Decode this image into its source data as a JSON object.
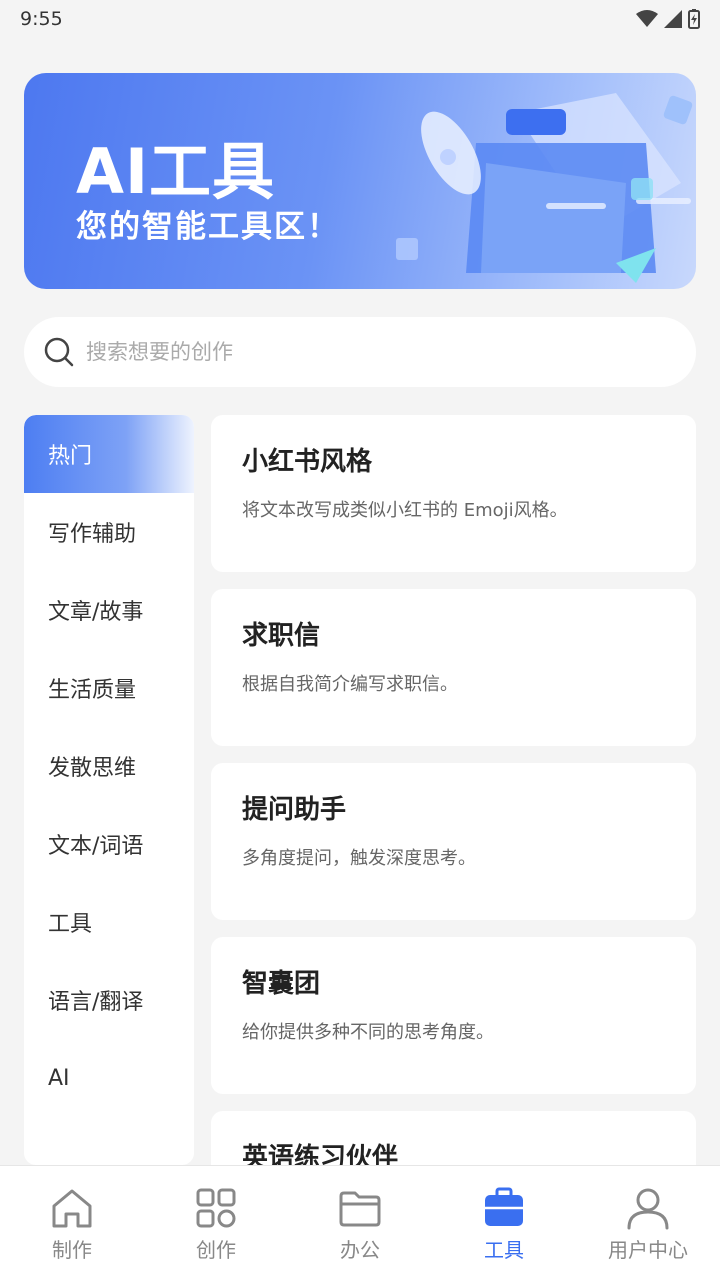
{
  "status_bar": {
    "time": "9:55"
  },
  "banner": {
    "title": "AI工具",
    "subtitle": "您的智能工具区！"
  },
  "search": {
    "placeholder": "搜索想要的创作",
    "value": ""
  },
  "categories": [
    {
      "label": "热门",
      "active": true
    },
    {
      "label": "写作辅助"
    },
    {
      "label": "文章/故事"
    },
    {
      "label": "生活质量"
    },
    {
      "label": "发散思维"
    },
    {
      "label": "文本/词语"
    },
    {
      "label": "工具"
    },
    {
      "label": "语言/翻译"
    },
    {
      "label": "AI"
    }
  ],
  "tools": [
    {
      "title": "小红书风格",
      "desc": "将文本改写成类似小红书的 Emoji风格。"
    },
    {
      "title": "求职信",
      "desc": "根据自我简介编写求职信。"
    },
    {
      "title": "提问助手",
      "desc": "多角度提问，触发深度思考。"
    },
    {
      "title": "智囊团",
      "desc": "给你提供多种不同的思考角度。"
    },
    {
      "title": "英语练习伙伴",
      "desc": ""
    }
  ],
  "nav": [
    {
      "label": "制作",
      "icon": "home-icon"
    },
    {
      "label": "创作",
      "icon": "grid-icon"
    },
    {
      "label": "办公",
      "icon": "folder-icon"
    },
    {
      "label": "工具",
      "icon": "toolbox-icon",
      "active": true
    },
    {
      "label": "用户中心",
      "icon": "user-icon"
    }
  ],
  "colors": {
    "accent": "#3a6ff0",
    "background": "#f4f4f4"
  }
}
